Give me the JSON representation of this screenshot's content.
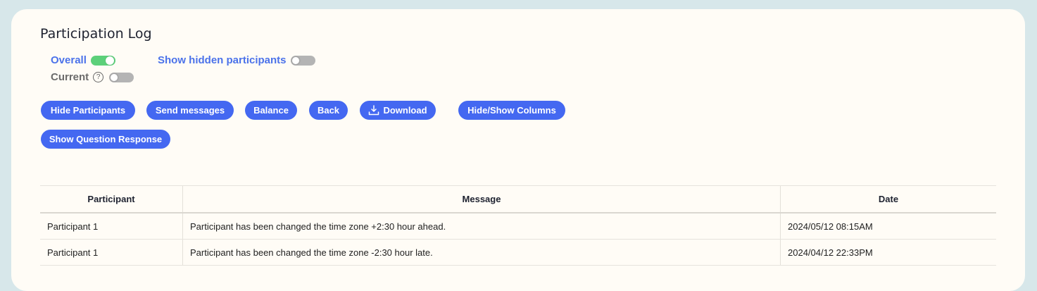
{
  "page": {
    "title": "Participation Log"
  },
  "toggles": {
    "overall": {
      "label": "Overall",
      "state": "on"
    },
    "current": {
      "label": "Current",
      "help": "?",
      "state": "off"
    },
    "show_hidden": {
      "label": "Show hidden participants",
      "state": "off"
    }
  },
  "buttons": {
    "hide_participants": "Hide Participants",
    "send_messages": "Send messages",
    "balance": "Balance",
    "back": "Back",
    "download": "Download",
    "hide_show_columns": "Hide/Show Columns",
    "show_question_response": "Show Question Response"
  },
  "table": {
    "headers": [
      "Participant",
      "Message",
      "Date"
    ],
    "rows": [
      [
        "Participant 1",
        "Participant has been changed the time zone +2:30 hour ahead.",
        "2024/05/12 08:15AM"
      ],
      [
        "Participant 1",
        "Participant has been changed the time zone -2:30 hour late.",
        "2024/04/12 22:33PM"
      ]
    ]
  },
  "colors": {
    "accent": "#4468f1",
    "toggle_on": "#5cd07a",
    "toggle_off": "#b4b4b4",
    "background": "#d7e7ea",
    "card": "#fffcf6"
  }
}
